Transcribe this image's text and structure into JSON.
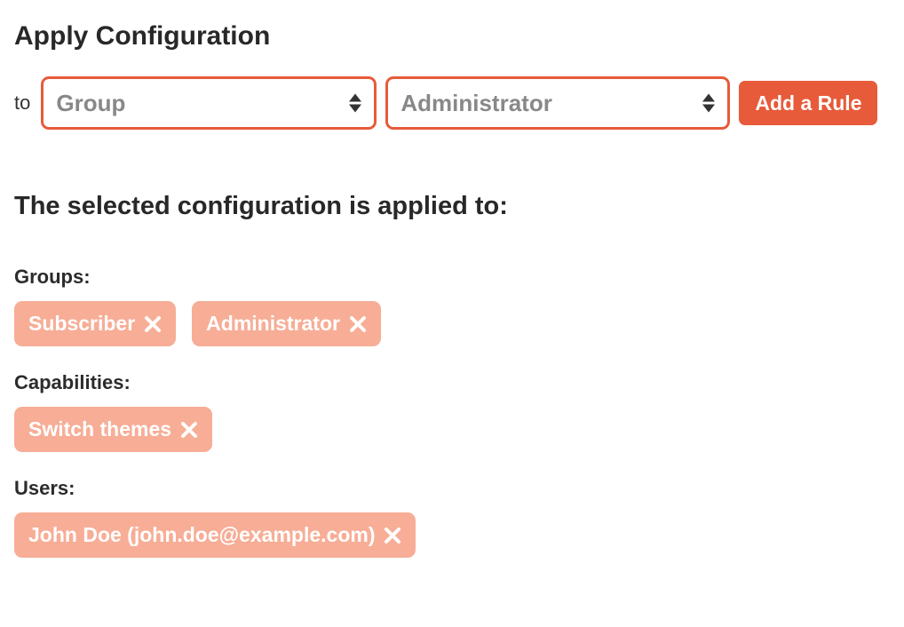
{
  "header": {
    "title": "Apply Configuration",
    "to_label": "to",
    "select_scope_value": "Group",
    "select_target_value": "Administrator",
    "add_button": "Add a Rule"
  },
  "applied_heading": "The selected configuration is applied to:",
  "sections": {
    "groups_label": "Groups:",
    "groups": [
      "Subscriber",
      "Administrator"
    ],
    "capabilities_label": "Capabilities:",
    "capabilities": [
      "Switch themes"
    ],
    "users_label": "Users:",
    "users": [
      "John Doe (john.doe@example.com)"
    ]
  }
}
